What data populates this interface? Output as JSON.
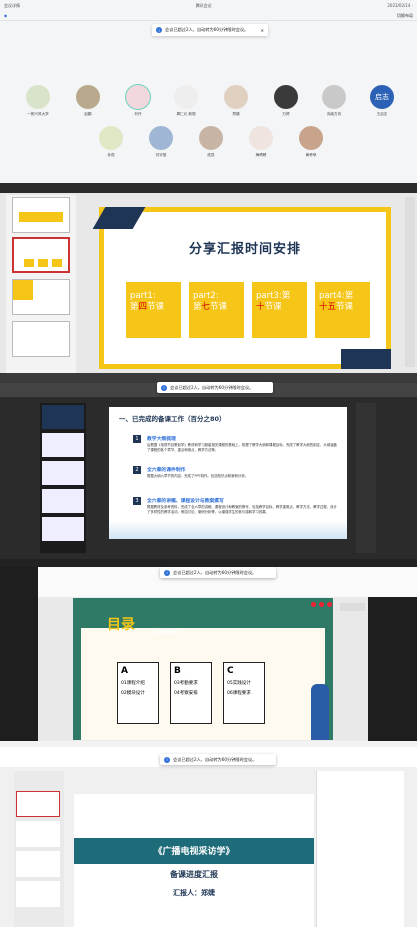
{
  "meeting": {
    "title": "腾讯会议",
    "brand": "会议详情",
    "timer": "2023/02/14 ·",
    "speaker_view": "切换布局",
    "banner": "会议已超过2人，自动转为60分钟限时会议。",
    "row1": [
      {
        "name": "一帆兴风大学"
      },
      {
        "name": "赵鹏"
      },
      {
        "name": "刘丹"
      },
      {
        "name": "周仁元 新丽"
      },
      {
        "name": "郑婕"
      },
      {
        "name": "万婷"
      },
      {
        "name": "向南方向"
      },
      {
        "name": "王启志"
      }
    ],
    "row2": [
      {
        "name": "孙茹"
      },
      {
        "name": "刘宇莹"
      },
      {
        "name": "庞凯"
      },
      {
        "name": "梅晴晴"
      },
      {
        "name": "黄菲菲"
      }
    ],
    "avatar_text_last": "启志"
  },
  "slide1": {
    "title": "分享汇报时间安排",
    "parts": [
      {
        "a": "part1:",
        "b": "第",
        "c": "四",
        "d": "节课"
      },
      {
        "a": "part2:",
        "b": "第",
        "c": "七",
        "d": "节课"
      },
      {
        "a": "part3:第",
        "b": "",
        "c": "十",
        "d": "节课"
      },
      {
        "a": "part4:第",
        "b": "",
        "c": "十五",
        "d": "节课"
      }
    ]
  },
  "slide2": {
    "heading": "一、已完成的备课工作（百分之80）",
    "banner": "会议已超过2人，自动转为60分钟限时会议。",
    "items": [
      {
        "num": "1",
        "title": "教学大纲梳理",
        "text": "后根据《电视节目策划学》教材和学习超星相关课程的基础上，梳理了教学大纲和课程目标，完成了教学大纲的制定，大纲涵盖了课程的各个章节、重点和难点，教学方法等。"
      },
      {
        "num": "2",
        "title": "全六章的课件制作",
        "text": "根据大纲六章节的内容，完成了PPT制作。包括知识点和案例分析。"
      },
      {
        "num": "3",
        "title": "全六章的讲稿、课程设计与教案撰写",
        "text": "根据教材及参考资料，完成了全六章的讲稿、课程设计和教案的撰写，包括教学目标、教学重难点、教学方法、教学过程、设计了多样性的教学活动，例如讨论、案例分析等，以增强学生的参与感和学习效果。"
      }
    ]
  },
  "slide3": {
    "title": "目录",
    "sub": "CONTENTS",
    "banner": "会议已超过2人，自动转为60分钟限时会议。",
    "cols": [
      {
        "letter": "A",
        "l1": "01课程介绍",
        "l2": "02模块设计"
      },
      {
        "letter": "B",
        "l1": "03考勤要求",
        "l2": "04考察安排"
      },
      {
        "letter": "C",
        "l1": "05实践设计",
        "l2": "06课程要求"
      }
    ]
  },
  "slide4": {
    "title": "《广播电视采访学》",
    "subtitle": "备课进度汇报",
    "reporter": "汇报人：郑婕",
    "banner": "会议已超过2人，自动转为60分钟限时会议。"
  }
}
